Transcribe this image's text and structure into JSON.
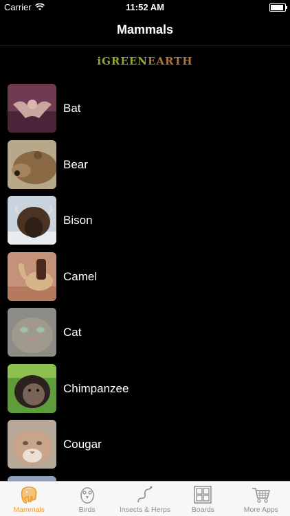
{
  "status_bar": {
    "carrier": "Carrier",
    "time": "11:52 AM"
  },
  "nav": {
    "title": "Mammals"
  },
  "logo": {
    "part1": "iGREEN",
    "part2": "EARTH"
  },
  "animals": [
    {
      "label": "Bat",
      "icon": "bat-thumbnail"
    },
    {
      "label": "Bear",
      "icon": "bear-thumbnail"
    },
    {
      "label": "Bison",
      "icon": "bison-thumbnail"
    },
    {
      "label": "Camel",
      "icon": "camel-thumbnail"
    },
    {
      "label": "Cat",
      "icon": "cat-thumbnail"
    },
    {
      "label": "Chimpanzee",
      "icon": "chimpanzee-thumbnail"
    },
    {
      "label": "Cougar",
      "icon": "cougar-thumbnail"
    }
  ],
  "tabs": [
    {
      "label": "Mammals",
      "icon": "elephant-icon",
      "active": true
    },
    {
      "label": "Birds",
      "icon": "bird-icon",
      "active": false
    },
    {
      "label": "Insects & Herps",
      "icon": "snake-icon",
      "active": false
    },
    {
      "label": "Boards",
      "icon": "boards-icon",
      "active": false
    },
    {
      "label": "More Apps",
      "icon": "cart-icon",
      "active": false
    }
  ],
  "colors": {
    "accent": "#f39a1e",
    "logo_green": "#9aa634",
    "logo_brown": "#b07838",
    "background": "#000000"
  }
}
